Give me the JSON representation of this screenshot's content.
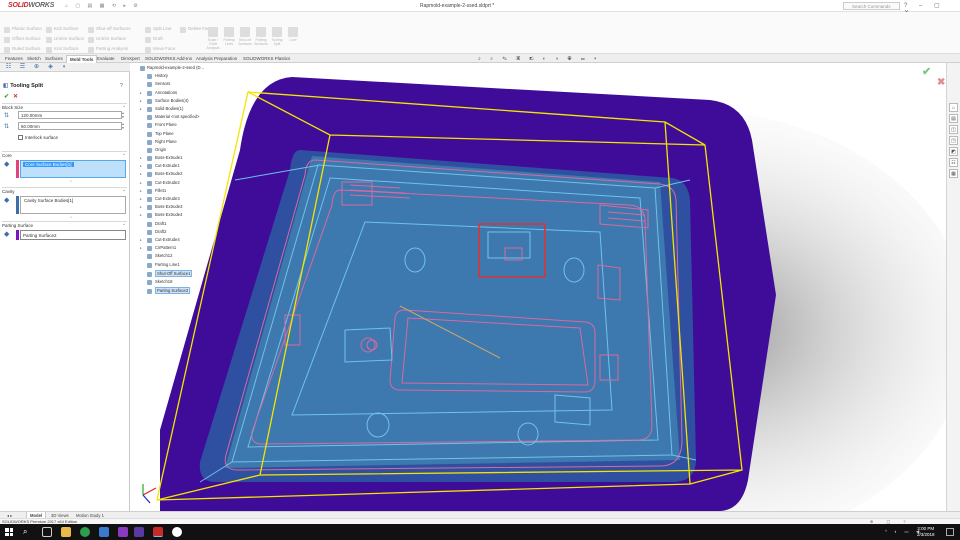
{
  "window": {
    "logo_brand": "SOLID",
    "logo_brand2": "WORKS",
    "doc_title": "Rapmold-example-2-ssed.sldprt *",
    "search_placeholder": "Search Commands",
    "quick_access": "⌂ ▢ ▤ ▦ ⟲ ▸ ⚙",
    "window_controls": "? – ▢ ✕"
  },
  "ribbon": {
    "col1": [
      "Planar Surface",
      "Offset Surface",
      "Ruled Surface"
    ],
    "col2": [
      "Knit Surface",
      "Untrim Surface",
      "Knit Surface"
    ],
    "col3": [
      "Shut-off Surfaces",
      "Untrim Surface",
      "Parting Analysis"
    ],
    "col4": [
      "Split Line",
      "Draft",
      "Move Face"
    ],
    "col5": [
      "Delete Face",
      "",
      ""
    ],
    "big": [
      "Scale / Draft Analysis",
      "Parting Lines",
      "Shut-off Surfaces",
      "Parting Surfaces",
      "Tooling Split",
      "Core"
    ]
  },
  "tabs": [
    "Features",
    "Sketch",
    "Surfaces",
    "Mold Tools",
    "Evaluate",
    "DimXpert",
    "SOLIDWORKS Add-Ins",
    "Analysis Preparation",
    "SOLIDWORKS Plastics"
  ],
  "headsup_icons": "⌕ ⌕ ✎ ▣ ◩ ◐ ◑ ◉ ▭ ▾",
  "left_tabs": [
    "☷",
    "☰",
    "⊕",
    "◈",
    "◐"
  ],
  "property": {
    "title": "Tooling Split",
    "help": "?",
    "ok": "✔",
    "cancel": "✕",
    "block_size": {
      "header": "Block Size",
      "dir1_value": "120.00mm",
      "dir2_value": "60.00mm",
      "interlock_label": "Interlock surface"
    },
    "core": {
      "header": "Core",
      "item": "Core Surface Bodies[1]",
      "stripe": "#e0457a"
    },
    "cavity": {
      "header": "Cavity",
      "item": "Cavity Surface Bodies[1]",
      "stripe": "#3a6ea5"
    },
    "parting_surface": {
      "header": "Parting Surface",
      "item": "Parting Surface2",
      "stripe": "#7b12c4"
    }
  },
  "tree": [
    {
      "label": "Rapmold-example-2-ssed (D...",
      "expanded": true,
      "top": true
    },
    {
      "label": "History",
      "expanded": false
    },
    {
      "label": "Sensors",
      "expanded": false
    },
    {
      "label": "Annotations",
      "expanded": true
    },
    {
      "label": "Surface Bodies(4)",
      "expanded": true
    },
    {
      "label": "Solid Bodies(1)",
      "expanded": true
    },
    {
      "label": "Material <not specified>",
      "expanded": false
    },
    {
      "label": "Front Plane",
      "expanded": false
    },
    {
      "label": "Top Plane",
      "expanded": false
    },
    {
      "label": "Right Plane",
      "expanded": false
    },
    {
      "label": "Origin",
      "expanded": false
    },
    {
      "label": "Boss-Extrude1",
      "expanded": true
    },
    {
      "label": "Cut-Extrude1",
      "expanded": true
    },
    {
      "label": "Boss-Extrude2",
      "expanded": true
    },
    {
      "label": "Cut-Extrude2",
      "expanded": true
    },
    {
      "label": "Fillet1",
      "expanded": true
    },
    {
      "label": "Cut-Extrude3",
      "expanded": true
    },
    {
      "label": "Boss-Extrude3",
      "expanded": true
    },
    {
      "label": "Boss-Extrude4",
      "expanded": true
    },
    {
      "label": "Draft1",
      "expanded": false
    },
    {
      "label": "Draft2",
      "expanded": false
    },
    {
      "label": "Cut-Extrude4",
      "expanded": true
    },
    {
      "label": "CirPattern1",
      "expanded": true
    },
    {
      "label": "Sketch12",
      "expanded": false
    },
    {
      "label": "Parting Line1",
      "expanded": false
    },
    {
      "label": "Shut-Off Surface1",
      "expanded": false,
      "selected": true
    },
    {
      "label": "Sketch18",
      "expanded": false
    },
    {
      "label": "Parting Surface2",
      "expanded": false,
      "selected": true
    }
  ],
  "right_icons": [
    "⌂",
    "▤",
    "◫",
    "◳",
    "◩",
    "☷",
    "▦"
  ],
  "bottom_tabs": [
    "◂ ▸",
    "Model",
    "3D Views",
    "Motion Study 1"
  ],
  "status": {
    "text": "SOLIDWORKS Premium 2017 x64 Edition",
    "right": "⊕ ▢ ?"
  },
  "taskbar": {
    "tray": "^ ◐ ▭ ◀",
    "time": "2:00 PM",
    "date": "2/3/2018"
  },
  "colors": {
    "mold_block": "#3f0c9a",
    "mold_inner": "#2f4fa0",
    "part_fill": "#3f7fb0",
    "wire_cyan": "#6fc3ea",
    "wire_pink": "#d86aa0",
    "bbox_yellow": "#f4e400",
    "select_red": "#e03030"
  }
}
